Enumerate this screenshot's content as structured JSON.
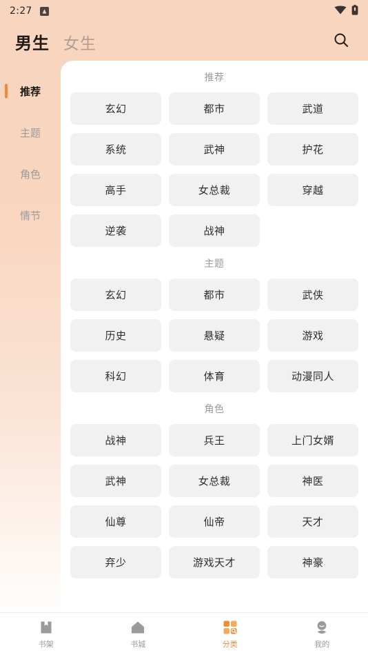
{
  "status_bar": {
    "time": "2:27",
    "app_badge_icon": "app-badge-icon",
    "wifi_icon": "wifi-icon",
    "battery_icon": "battery-icon"
  },
  "colors": {
    "accent": "#ef8c3c",
    "header_bg": "#f8d5be",
    "chip_bg": "#f1f1f1",
    "panel_bg": "#ffffff",
    "muted_text": "#9a9a9a"
  },
  "topbar": {
    "tabs": [
      {
        "label": "男生",
        "active": true
      },
      {
        "label": "女生",
        "active": false
      }
    ],
    "search_icon": "search-icon"
  },
  "rail": {
    "items": [
      {
        "label": "推荐",
        "active": true
      },
      {
        "label": "主题",
        "active": false
      },
      {
        "label": "角色",
        "active": false
      },
      {
        "label": "情节",
        "active": false
      }
    ]
  },
  "sections": [
    {
      "title": "推荐",
      "tags": [
        "玄幻",
        "都市",
        "武道",
        "系统",
        "武神",
        "护花",
        "高手",
        "女总裁",
        "穿越",
        "逆袭",
        "战神"
      ]
    },
    {
      "title": "主题",
      "tags": [
        "玄幻",
        "都市",
        "武侠",
        "历史",
        "悬疑",
        "游戏",
        "科幻",
        "体育",
        "动漫同人"
      ]
    },
    {
      "title": "角色",
      "tags": [
        "战神",
        "兵王",
        "上门女婿",
        "武神",
        "女总裁",
        "神医",
        "仙尊",
        "仙帝",
        "天才",
        "弃少",
        "游戏天才",
        "神豪"
      ]
    }
  ],
  "bottom_nav": {
    "items": [
      {
        "label": "书架",
        "icon": "bookshelf-icon",
        "active": false
      },
      {
        "label": "书城",
        "icon": "home-icon",
        "active": false
      },
      {
        "label": "分类",
        "icon": "grid-search-icon",
        "active": true
      },
      {
        "label": "我的",
        "icon": "profile-icon",
        "active": false
      }
    ]
  }
}
